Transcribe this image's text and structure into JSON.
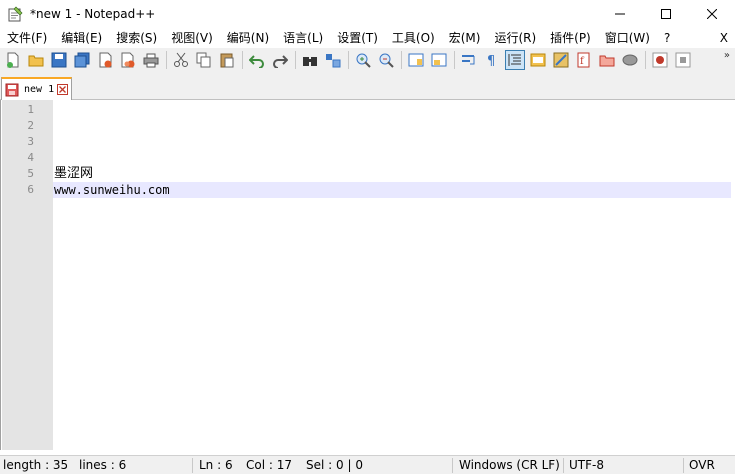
{
  "window": {
    "title": "*new 1 - Notepad++",
    "minimize": "—",
    "maximize": "☐",
    "close": "✕"
  },
  "menu": {
    "items": [
      "文件(F)",
      "编辑(E)",
      "搜索(S)",
      "视图(V)",
      "编码(N)",
      "语言(L)",
      "设置(T)",
      "工具(O)",
      "宏(M)",
      "运行(R)",
      "插件(P)",
      "窗口(W)",
      "?"
    ],
    "close_label": "X"
  },
  "toolbar": {
    "buttons": [
      "new-icon",
      "open-icon",
      "save-icon",
      "save-all-icon",
      "close-icon",
      "close-all-icon",
      "print-icon",
      "cut-icon",
      "copy-icon",
      "paste-icon",
      "undo-icon",
      "redo-icon",
      "find-icon",
      "replace-icon",
      "zoom-in-icon",
      "zoom-out-icon",
      "sync-vertical-icon",
      "sync-horizontal-icon",
      "word-wrap-icon",
      "show-all-chars-icon",
      "indent-guide-icon",
      "document-map-icon",
      "function-list-icon",
      "folder-workspace-icon",
      "monitoring-icon",
      "record-macro-icon",
      "stop-record-icon"
    ],
    "more_label": "»"
  },
  "tabs": [
    {
      "label": "new 1",
      "modified": true
    }
  ],
  "editor": {
    "lines": [
      "",
      "",
      "",
      "",
      "墨涩网",
      "www.sunweihu.com"
    ],
    "line_numbers": [
      "1",
      "2",
      "3",
      "4",
      "5",
      "6"
    ],
    "current_line": 6
  },
  "status": {
    "length": "length : 35",
    "lines": "lines : 6",
    "ln": "Ln : 6",
    "col": "Col : 17",
    "sel": "Sel : 0 | 0",
    "eol": "Windows (CR LF)",
    "encoding": "UTF-8",
    "mode": "OVR"
  },
  "colors": {
    "current_line_bg": "#e8e8ff",
    "gutter_bg": "#e4e4e4",
    "active_tab_accent": "#f9a825",
    "toolbar_bg": "#f0f0f0"
  }
}
